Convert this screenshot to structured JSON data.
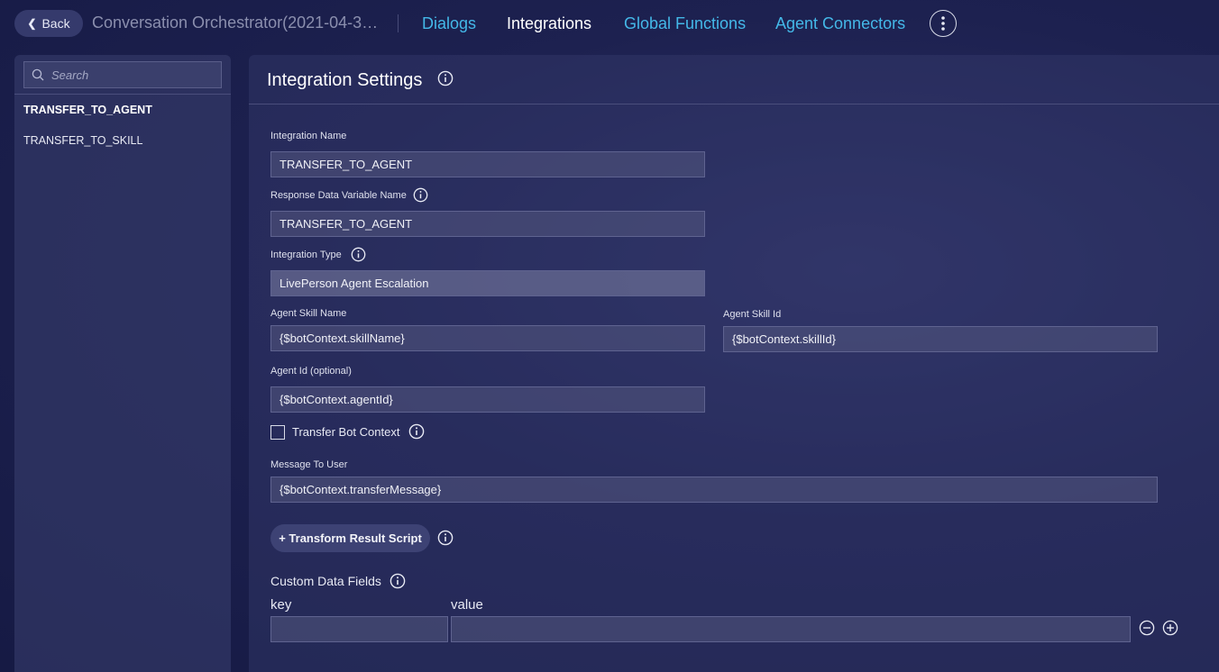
{
  "topbar": {
    "back_label": "Back",
    "app_title": "Conversation Orchestrator(2021-04-30...",
    "nav": [
      {
        "label": "Dialogs",
        "active": false
      },
      {
        "label": "Integrations",
        "active": true
      },
      {
        "label": "Global Functions",
        "active": false
      },
      {
        "label": "Agent Connectors",
        "active": false
      }
    ]
  },
  "sidebar": {
    "search_placeholder": "Search",
    "items": [
      {
        "label": "TRANSFER_TO_AGENT",
        "active": true
      },
      {
        "label": "TRANSFER_TO_SKILL",
        "active": false
      }
    ]
  },
  "main": {
    "title": "Integration Settings",
    "fields": {
      "integration_name": {
        "label": "Integration Name",
        "value": "TRANSFER_TO_AGENT"
      },
      "response_var": {
        "label": "Response Data Variable Name",
        "value": "TRANSFER_TO_AGENT"
      },
      "integration_type": {
        "label": "Integration Type",
        "value": "LivePerson Agent Escalation"
      },
      "agent_skill_name": {
        "label": "Agent Skill Name",
        "value": "{$botContext.skillName}"
      },
      "agent_skill_id": {
        "label": "Agent Skill Id",
        "value": "{$botContext.skillId}"
      },
      "agent_id": {
        "label": "Agent Id (optional)",
        "value": "{$botContext.agentId}"
      },
      "message_to_user": {
        "label": "Message To User",
        "value": "{$botContext.transferMessage}"
      }
    },
    "transfer_bot_context_label": "Transfer Bot Context",
    "transform_button_label": "+ Transform Result Script",
    "custom_data": {
      "label": "Custom Data Fields",
      "key_header": "key",
      "value_header": "value",
      "key_value": "",
      "value_value": ""
    }
  },
  "colors": {
    "background": "#1d2150",
    "nav_link": "#44b8e8",
    "nav_active": "#ffffff",
    "panel": "#3a3f70"
  },
  "icons": [
    "chevron-left-icon",
    "more-vertical-icon",
    "search-icon",
    "info-icon",
    "minus-circle-icon",
    "plus-circle-icon"
  ]
}
